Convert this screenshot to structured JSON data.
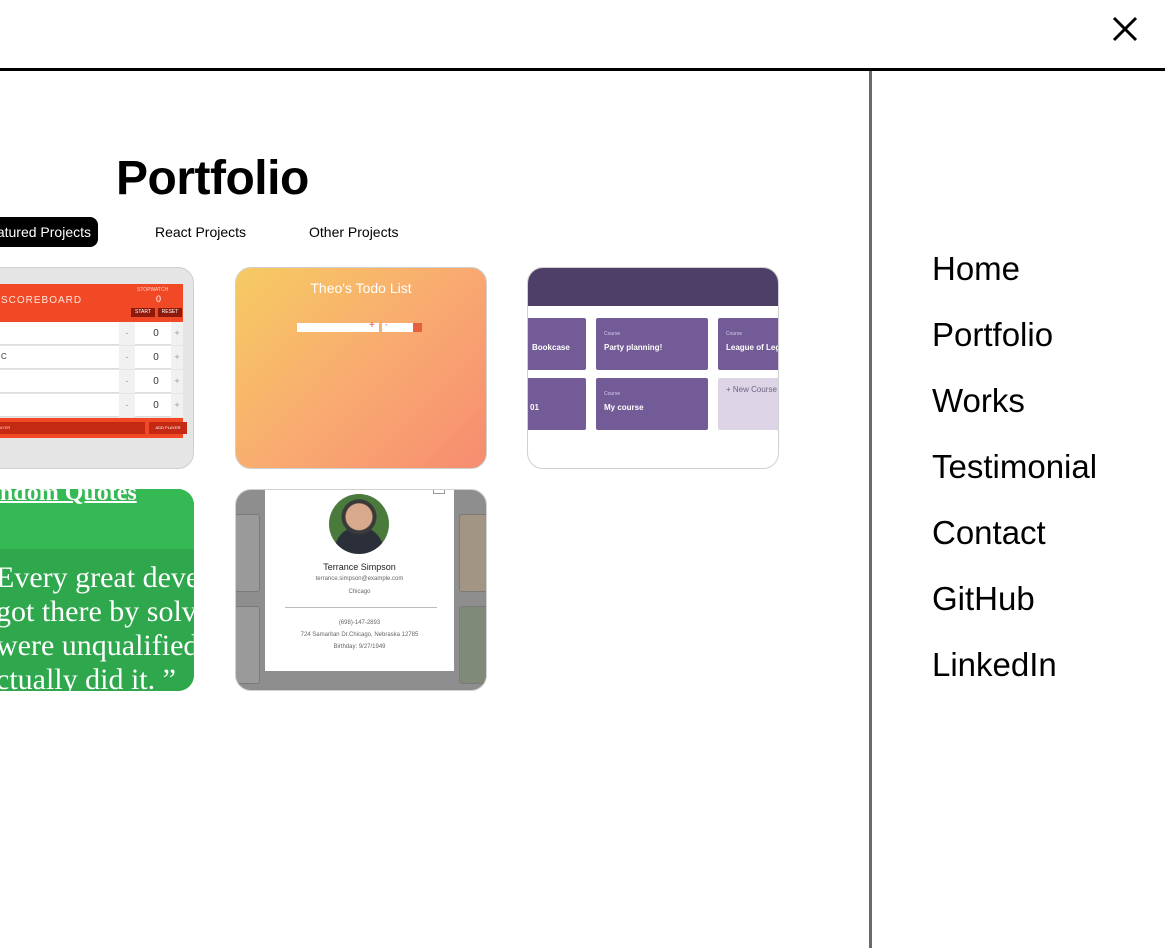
{
  "portfolio": {
    "title": "Portfolio",
    "tabs": [
      {
        "label": "Featured Projects",
        "active": true
      },
      {
        "label": "React Projects",
        "active": false
      },
      {
        "label": "Other Projects",
        "active": false
      }
    ],
    "cards": {
      "scoreboard": {
        "title": "SCOREBOARD",
        "stopwatch": "STOPWATCH",
        "time": "0",
        "start": "START",
        "reset": "RESET",
        "players": [
          {
            "name": "",
            "score": "0"
          },
          {
            "name": "C",
            "score": "0"
          },
          {
            "name": "",
            "score": "0"
          },
          {
            "name": "",
            "score": "0"
          }
        ],
        "minus": "-",
        "plus": "+",
        "input_placeholder": "E PLAYER",
        "add_player": "ADD PLAYER"
      },
      "todo": {
        "title": "Theo's Todo List",
        "plus": "+",
        "dash": "-",
        "arrow": "▾"
      },
      "courses": {
        "tiles": [
          {
            "label": "",
            "name": "Bookcase"
          },
          {
            "label": "Course",
            "name": "Party planning!"
          },
          {
            "label": "Course",
            "name": "League of Lege"
          },
          {
            "label": "",
            "name": "01"
          },
          {
            "label": "Course",
            "name": "My course"
          },
          {
            "label": "",
            "name": "+ New Course"
          }
        ]
      },
      "quotes": {
        "heading": "ndom Quotes",
        "lines": [
          "Every great deve",
          "got there by solv",
          "were unqualified",
          "ctually did it. ”"
        ]
      },
      "contact": {
        "name": "Terrance Simpson",
        "email": "terrance.simpson@example.com",
        "city": "Chicago",
        "phone": "(698)-147-2893",
        "address": "724 Samaritan Dr.Chicago, Nebraska 12785",
        "birthday": "Birthday: 9/27/1949"
      }
    }
  },
  "nav": {
    "items": [
      "Home",
      "Portfolio",
      "Works",
      "Testimonial",
      "Contact",
      "GitHub",
      "LinkedIn"
    ]
  },
  "icons": {
    "close": "close-icon"
  },
  "colors": {
    "accent": "#000000",
    "divider": "#6a6a6a"
  }
}
